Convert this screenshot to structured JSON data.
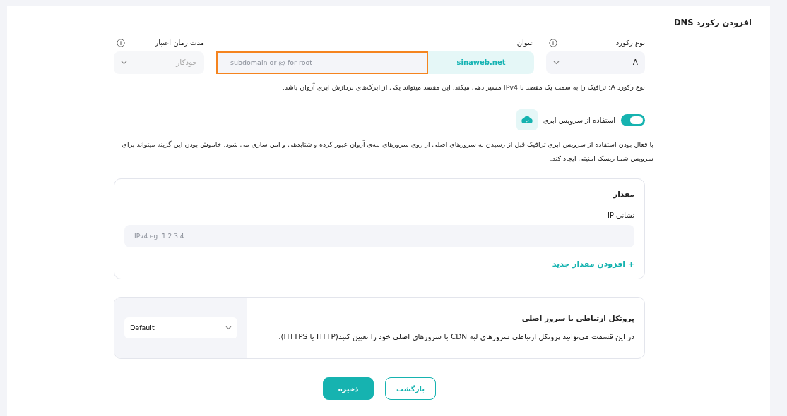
{
  "page_title": "افزودن رکورد DNS",
  "fields": [
    {
      "kind": "select",
      "label": "نوع رکورد",
      "info": true,
      "value": "A",
      "disabled": false
    },
    {
      "kind": "domain",
      "label": "عنوان",
      "suffix": "sinaweb.net",
      "placeholder": "subdomain or @ for root",
      "highlighted": true
    },
    {
      "kind": "select",
      "label": "مدت زمان اعتبار",
      "info": true,
      "value": "خودکار",
      "disabled": true
    }
  ],
  "record_hint": "نوع رکورد A: ترافیک را به سمت یک مقصد با IPv4 مسیر دهی میکند. این مقصد میتواند یکی از ابرک‌های پردازش ابری آروان باشد.",
  "cloud": {
    "on": true,
    "label": "استفاده از سرویس ابری",
    "description": "با فعال بودن استفاده از سرویس ابری ترافیک قبل از رسیدن به سرورهای اصلی از روی سرورهای لبه‌ی آروان عبور کرده و شتابدهی و امن سازی می شود. خاموش بودن این گزینه میتواند برای سرویس شما ریسک امنیتی ایجاد کند."
  },
  "value_card": {
    "title": "مقدار",
    "field_label": "نشانی IP",
    "placeholder": "IPv4 eg. 1.2.3.4",
    "add_icon": "+",
    "add_link": "افزودن مقدار جدید"
  },
  "protocol": {
    "title": "پروتکل ارتباطی با سرور اصلی",
    "description": "در این قسمت می‌توانید پروتکل ارتباطی سرورهای لبه CDN با سرورهای اصلی خود را تعیین کنید(HTTP یا HTTPS).",
    "value": "Default"
  },
  "buttons": [
    {
      "kind": "outline",
      "label": "بازگشت"
    },
    {
      "kind": "primary",
      "label": "ذخیره"
    }
  ]
}
